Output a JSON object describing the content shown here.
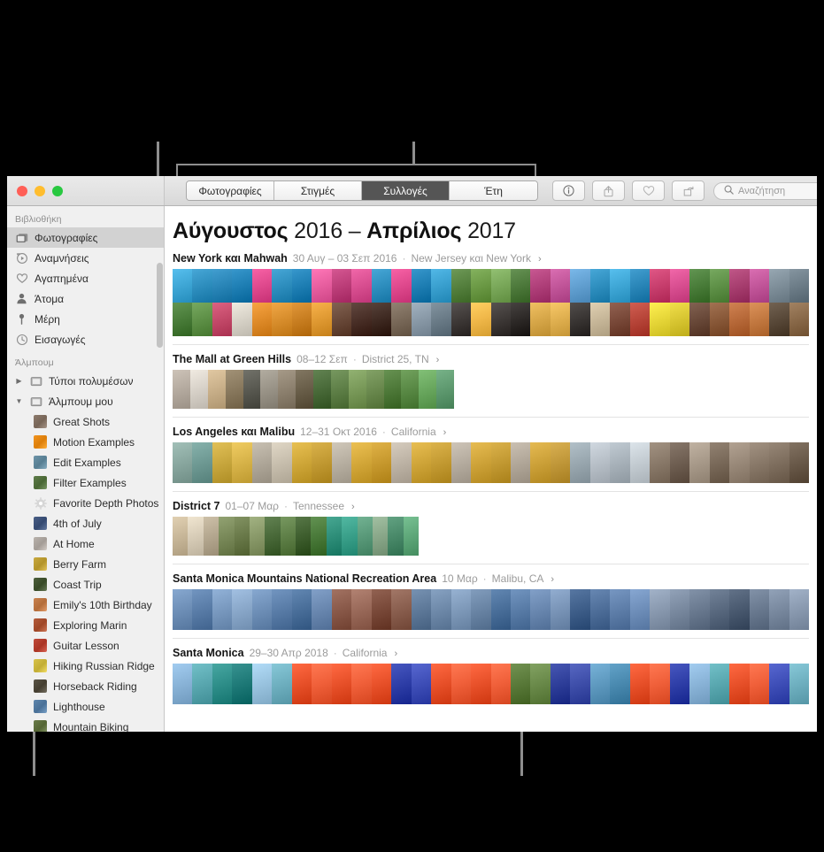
{
  "window": {
    "traffic_lights": [
      "close",
      "minimize",
      "zoom"
    ],
    "colors": {
      "close": "#ff5f57",
      "minimize": "#ffbd2e",
      "zoom": "#28c840",
      "accent_selected_tab": "#555555"
    }
  },
  "toolbar": {
    "tabs": [
      {
        "label": "Φωτογραφίες",
        "selected": false
      },
      {
        "label": "Στιγμές",
        "selected": false
      },
      {
        "label": "Συλλογές",
        "selected": true
      },
      {
        "label": "Έτη",
        "selected": false
      }
    ],
    "buttons": [
      {
        "name": "info-icon",
        "label": "Πληροφορίες"
      },
      {
        "name": "share-icon",
        "label": "Κοινή χρήση"
      },
      {
        "name": "heart-icon",
        "label": "Αγαπημένο"
      },
      {
        "name": "rotate-icon",
        "label": "Περιστροφή"
      }
    ],
    "search": {
      "placeholder": "Αναζήτηση",
      "value": "",
      "icon": "search-icon"
    }
  },
  "sidebar": {
    "groups": [
      {
        "title": "Βιβλιοθήκη",
        "items": [
          {
            "label": "Φωτογραφίες",
            "icon": "photos-icon",
            "selected": true
          },
          {
            "label": "Αναμνήσεις",
            "icon": "memories-icon",
            "selected": false
          },
          {
            "label": "Αγαπημένα",
            "icon": "heart-icon",
            "selected": false
          },
          {
            "label": "Άτομα",
            "icon": "person-icon",
            "selected": false
          },
          {
            "label": "Μέρη",
            "icon": "pin-icon",
            "selected": false
          },
          {
            "label": "Εισαγωγές",
            "icon": "clock-icon",
            "selected": false
          }
        ]
      },
      {
        "title": "Άλμπουμ",
        "items": [
          {
            "label": "Τύποι πολυμέσων",
            "icon": "folder-icon",
            "disclosure": "collapsed",
            "selected": false
          },
          {
            "label": "Άλμπουμ μου",
            "icon": "folder-icon",
            "disclosure": "expanded",
            "selected": false
          },
          {
            "label": "Great Shots",
            "icon": "album-thumb",
            "thumb": "#8d7b6d",
            "indent": 2,
            "selected": false
          },
          {
            "label": "Motion Examples",
            "icon": "album-thumb",
            "thumb": "#f2941f",
            "indent": 2,
            "selected": false
          },
          {
            "label": "Edit Examples",
            "icon": "album-thumb",
            "thumb": "#6d94a8",
            "indent": 2,
            "selected": false
          },
          {
            "label": "Filter Examples",
            "icon": "album-thumb",
            "thumb": "#5f7d4a",
            "indent": 2,
            "selected": false
          },
          {
            "label": "Favorite Depth Photos",
            "icon": "gear-icon",
            "indent": 2,
            "selected": false
          },
          {
            "label": "4th of July",
            "icon": "album-thumb",
            "thumb": "#4a5f86",
            "indent": 2,
            "selected": false
          },
          {
            "label": "At Home",
            "icon": "album-thumb",
            "thumb": "#b9b2ac",
            "indent": 2,
            "selected": false
          },
          {
            "label": "Berry Farm",
            "icon": "album-thumb",
            "thumb": "#c8a93f",
            "indent": 2,
            "selected": false
          },
          {
            "label": "Coast Trip",
            "icon": "album-thumb",
            "thumb": "#4d5f3c",
            "indent": 2,
            "selected": false
          },
          {
            "label": "Emily's 10th Birthday",
            "icon": "album-thumb",
            "thumb": "#c9824f",
            "indent": 2,
            "selected": false
          },
          {
            "label": "Exploring Marin",
            "icon": "album-thumb",
            "thumb": "#b45c3c",
            "indent": 2,
            "selected": false
          },
          {
            "label": "Guitar Lesson",
            "icon": "album-thumb",
            "thumb": "#c04a3a",
            "indent": 2,
            "selected": false
          },
          {
            "label": "Hiking Russian Ridge",
            "icon": "album-thumb",
            "thumb": "#d8c34a",
            "indent": 2,
            "selected": false
          },
          {
            "label": "Horseback Riding",
            "icon": "album-thumb",
            "thumb": "#5a5446",
            "indent": 2,
            "selected": false
          },
          {
            "label": "Lighthouse",
            "icon": "album-thumb",
            "thumb": "#5f86ad",
            "indent": 2,
            "selected": false
          },
          {
            "label": "Mountain Biking",
            "icon": "album-thumb",
            "thumb": "#6a7b4a",
            "indent": 2,
            "selected": false
          }
        ]
      }
    ]
  },
  "main": {
    "title": {
      "month_start": "Αύγουστος",
      "year_start": "2016",
      "dash": "–",
      "month_end": "Απρίλιος",
      "year_end": "2017"
    },
    "sections": [
      {
        "title": "New York και Mahwah",
        "dates": "30 Αυγ – 03 Σεπ 2016",
        "separator": "·",
        "place": "New Jersey και New York",
        "chevron": "›",
        "rows": 2,
        "strip_height": 76,
        "colors": [
          "#3fa7d6",
          "#2f8fbf",
          "#2a86b8",
          "#1f7fb4",
          "#e04a8e",
          "#2f8fbf",
          "#1f7fb4",
          "#e85fa0",
          "#bd3f7a",
          "#d94f91",
          "#2f8fbf",
          "#e04a8e",
          "#1f7fb4",
          "#3aa0cf",
          "#56813f",
          "#6c9a46",
          "#7aa85a",
          "#4e7a3c",
          "#b0407a",
          "#c2569a",
          "#62a0d1",
          "#2f8fbf",
          "#3fa7d6",
          "#2a86b8",
          "#c83f6e",
          "#d94f91",
          "#4a7d3a",
          "#5f9148",
          "#a83f70",
          "#c2569a",
          "#7f8f9a",
          "#6d7d88"
        ],
        "colors_row2": [
          "#4a7d3a",
          "#5f9148",
          "#c44a6a",
          "#d8d3c8",
          "#e08c2a",
          "#d98f2e",
          "#c97f22",
          "#e09a33",
          "#6a4a3a",
          "#4a3028",
          "#3f2a22",
          "#7a6a5a",
          "#8a9aa8",
          "#6b7c88",
          "#3f3a38",
          "#f0b84a",
          "#3f3a38",
          "#2e2a28",
          "#d8a84a",
          "#e0b050",
          "#3a3634",
          "#c8b89a",
          "#7a4a3a",
          "#b8463a",
          "#e8d83a",
          "#d9c733",
          "#6a4a3a",
          "#8a5a3a",
          "#b86a3a",
          "#c47a42",
          "#5a4a3a",
          "#8a6a4a"
        ]
      },
      {
        "title": "The Mall at Green Hills",
        "dates": "08–12 Σεπ",
        "separator": "·",
        "place": "District 25, TN",
        "chevron": "›",
        "rows": 1,
        "strip_height": 44,
        "strip_width": 318,
        "colors": [
          "#b5aba0",
          "#d8d2c9",
          "#c9b08a",
          "#8a7a5f",
          "#5a5a52",
          "#9a9488",
          "#8e8270",
          "#6a5f4a",
          "#4a6b3a",
          "#5f8048",
          "#7a9a5a",
          "#6b8a4f",
          "#4f7a3a",
          "#5a8a46",
          "#6aa85f",
          "#5f9a70"
        ]
      },
      {
        "title": "Los Angeles και Malibu",
        "dates": "12–31 Οκτ 2016",
        "separator": "·",
        "place": "California",
        "chevron": "›",
        "rows": 1,
        "strip_height": 46,
        "colors": [
          "#8aa8a0",
          "#6f9a94",
          "#c9a83f",
          "#d8b44a",
          "#b0a89a",
          "#c8bfae",
          "#d0a83a",
          "#c29a33",
          "#b8b0a2",
          "#d4a83a",
          "#c89a2f",
          "#beb4a6",
          "#d0a63a",
          "#c49b33",
          "#b6ada0",
          "#cfa43a",
          "#c39a33",
          "#b2a89a",
          "#cda23a",
          "#c1983a",
          "#9aa8b0",
          "#b8c0c8",
          "#a8b2ba",
          "#c4ccd2",
          "#8a7a6a",
          "#6f5f52",
          "#a89a8a",
          "#7a6a5a",
          "#9a8a7a",
          "#8a7a6a",
          "#7f6f5f",
          "#6a5a4a"
        ]
      },
      {
        "title": "District 7",
        "dates": "01–07 Μαρ",
        "separator": "·",
        "place": "Tennessee",
        "chevron": "›",
        "rows": 1,
        "strip_height": 44,
        "strip_width": 278,
        "colors": [
          "#c9b89a",
          "#d8cdb8",
          "#b5a890",
          "#7a8a5a",
          "#6a7a4a",
          "#8a9a6a",
          "#4a6a3a",
          "#5f8048",
          "#3f5f2f",
          "#4a7a3a",
          "#2f8f7a",
          "#3aa08a",
          "#5a9a7a",
          "#8aa88a",
          "#4a8a6a",
          "#5fa87a"
        ]
      },
      {
        "title": "Santa Monica Mountains National Recreation Area",
        "dates": "10 Μαρ",
        "separator": "·",
        "place": "Malibu, CA",
        "chevron": "›",
        "rows": 1,
        "strip_height": 46,
        "colors": [
          "#6f90b8",
          "#5a7da8",
          "#7a9ac0",
          "#8aa8ca",
          "#6f90b8",
          "#5a7da8",
          "#4a6f9a",
          "#6a88b0",
          "#8a5a4a",
          "#9a6a5a",
          "#7a4a3a",
          "#8a5f4f",
          "#5f7a9a",
          "#6f8aaa",
          "#7f9aba",
          "#6a85a5",
          "#4a6f9a",
          "#5a7da8",
          "#6a88b0",
          "#7a95b8",
          "#3f5f8a",
          "#4f6f9a",
          "#5f7faa",
          "#6f8fba",
          "#8a9ab0",
          "#7a8aa0",
          "#6a7a90",
          "#5a6a80",
          "#4a5a70",
          "#6a7a90",
          "#7a8aa0",
          "#8a9ab0"
        ]
      },
      {
        "title": "Santa Monica",
        "dates": "29–30 Απρ 2018",
        "separator": "·",
        "place": "California",
        "chevron": "›",
        "rows": 1,
        "strip_height": 46,
        "colors": [
          "#8ab4d8",
          "#5aa8b0",
          "#2f8f8a",
          "#1f7a78",
          "#9ac4e0",
          "#6fb0c0",
          "#e8512a",
          "#f0603a",
          "#e8512a",
          "#f0603a",
          "#e8512a",
          "#2f3fa8",
          "#3f4fb8",
          "#e8512a",
          "#f0603a",
          "#e8512a",
          "#f0603a",
          "#5a7a3a",
          "#6a8a4a",
          "#2f3f9a",
          "#3f4faa",
          "#5f9ac0",
          "#4a8ab0",
          "#e8512a",
          "#f0603a",
          "#2f3fa8",
          "#8ab4d8",
          "#5aa8b0",
          "#e8512a",
          "#f0603a",
          "#3f4fb8",
          "#6fb0c0"
        ]
      }
    ]
  },
  "callouts": {
    "sidebar_top_line": "pointer to sidebar",
    "tabs_line": "pointer to view tabs",
    "sidebar_bottom_line": "pointer to albums list",
    "content_bottom_line": "pointer to photo grid"
  }
}
